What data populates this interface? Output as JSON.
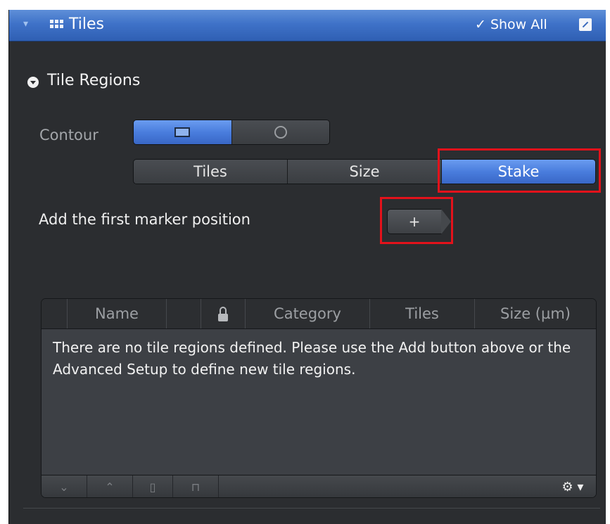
{
  "header": {
    "title": "Tiles",
    "show_all": "✓ Show All",
    "collapse_glyph": "▾",
    "accent": "#3f72c8"
  },
  "section": {
    "title": "Tile Regions"
  },
  "contour": {
    "label": "Contour",
    "options": [
      {
        "icon": "rectangle-icon",
        "selected": true
      },
      {
        "icon": "circle-icon",
        "selected": false
      }
    ]
  },
  "mode_tabs": [
    {
      "label": "Tiles",
      "selected": false
    },
    {
      "label": "Size",
      "selected": false
    },
    {
      "label": "Stake",
      "selected": true
    }
  ],
  "marker": {
    "hint": "Add the first marker position",
    "add_label": "+"
  },
  "table": {
    "columns": [
      "Name",
      "",
      "Category",
      "Tiles",
      "Size (µm)"
    ],
    "empty_message": "There are no tile regions defined. Please use the Add button above or the Advanced Setup to define new tile regions."
  },
  "footer": {
    "buttons": [
      "move-down-icon",
      "move-up-icon",
      "delete-icon",
      "unlock-icon"
    ],
    "gear_label": "⚙ ▾"
  },
  "highlight_color": "#e3121b"
}
